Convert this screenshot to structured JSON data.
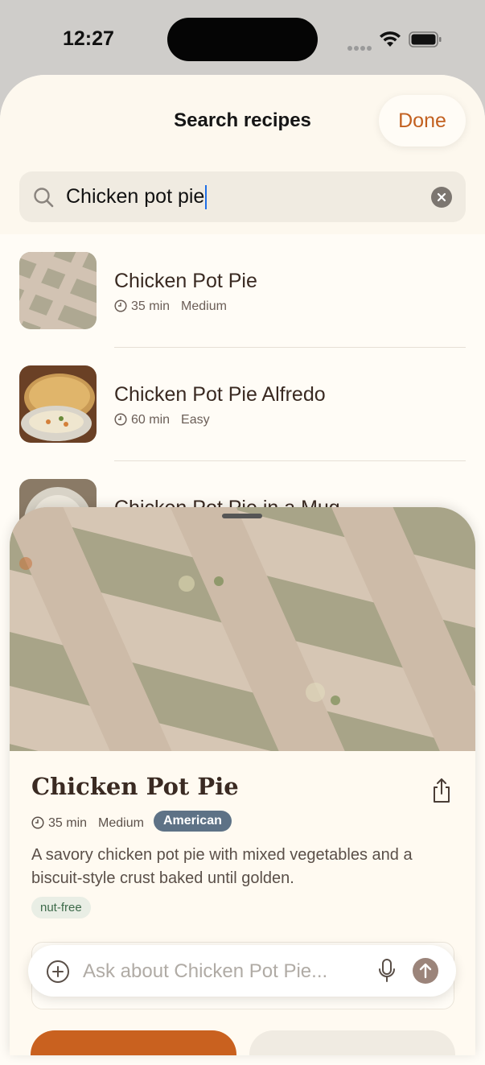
{
  "status_bar": {
    "time": "12:27"
  },
  "search_sheet": {
    "title": "Search recipes",
    "done_label": "Done",
    "search_value": "Chicken pot pie"
  },
  "results": [
    {
      "title": "Chicken Pot Pie",
      "time": "35 min",
      "difficulty": "Medium"
    },
    {
      "title": "Chicken Pot Pie Alfredo",
      "time": "60 min",
      "difficulty": "Easy"
    },
    {
      "title": "Chicken Pot Pie in a Mug"
    }
  ],
  "detail": {
    "title": "Chicken Pot Pie",
    "time": "35 min",
    "difficulty": "Medium",
    "cuisine": "American",
    "description": "A savory chicken pot pie with mixed vegetables and a biscuit-style crust baked until golden.",
    "tags": [
      "nut-free"
    ],
    "ask_placeholder": "Ask about Chicken Pot Pie..."
  },
  "colors": {
    "accent": "#c2601f",
    "sheet_background": "#fffcf6",
    "cuisine_badge": "#5e7286",
    "tag_background": "#e9eee5"
  },
  "icons": [
    "search-icon",
    "clear-icon",
    "clock-icon",
    "share-icon",
    "plus-icon",
    "microphone-icon",
    "send-arrow-icon",
    "wifi-icon",
    "battery-icon"
  ]
}
